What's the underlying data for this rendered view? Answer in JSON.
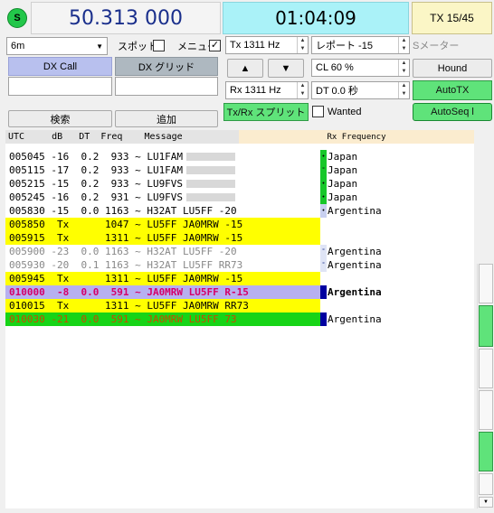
{
  "header": {
    "status_glyph": "S",
    "dial_frequency": "50.313 000",
    "utc_clock": "01:04:09",
    "tx_status": "TX 15/45"
  },
  "controls": {
    "band": "6m",
    "spot_label": "スポット",
    "menu_label": "メニュー",
    "menu_checked": "✓",
    "tx_freq": "Tx  1311  Hz",
    "report": "レポート -15",
    "smeter_label": "Sメーター",
    "cl": "CL  60 %",
    "rx_freq": "Rx  1311  Hz",
    "dt": "DT 0.0 秒",
    "hound": "Hound",
    "autotx": "AutoTX",
    "autoseq": "AutoSeq l",
    "txrx_split": "Tx/Rx スプリット",
    "wanted": "Wanted",
    "up_arrow": "▲",
    "down_arrow": "▼"
  },
  "dx": {
    "call_label": "DX Call",
    "grid_label": "DX グリッド",
    "search_button": "検索",
    "add_button": "追加"
  },
  "table": {
    "header": "UTC     dB   DT  Freq    Message",
    "rx_header": "Rx Frequency",
    "rows": [
      {
        "text": "005045 -16  0.2  933 ~ LU1FAM",
        "country": "Japan"
      },
      {
        "text": "005115 -17  0.2  933 ~ LU1FAM",
        "country": "Japan"
      },
      {
        "text": "005215 -15  0.2  933 ~ LU9FVS",
        "country": "Japan"
      },
      {
        "text": "005245 -16  0.2  931 ~ LU9FVS",
        "country": "Japan"
      },
      {
        "text": "005830 -15  0.0 1163 ~ H32AT LU5FF -20",
        "country": "Argentina"
      },
      {
        "text": "005850  Tx      1047 ~ LU5FF JA0MRW -15",
        "country": ""
      },
      {
        "text": "005915  Tx      1311 ~ LU5FF JA0MRW -15",
        "country": ""
      },
      {
        "text": "005900 -23  0.0 1163 ~ H32AT LU5FF -20",
        "country": "Argentina"
      },
      {
        "text": "005930 -20  0.1 1163 ~ H32AT LU5FF RR73",
        "country": "Argentina"
      },
      {
        "text": "005945  Tx      1311 ~ LU5FF JA0MRW -15",
        "country": ""
      },
      {
        "text": "010000  -8  0.0  591 ~ JA0MRW LU5FF R-15",
        "country": "Argentina"
      },
      {
        "text": "010015  Tx      1311 ~ LU5FF JA0MRW RR73",
        "country": ""
      },
      {
        "text": "010030 -21  0.0  591 ~ JA0MRW LU5FF 73",
        "country": "Argentina"
      }
    ]
  },
  "colors": {
    "green_dot": "#22c74a",
    "freq_text": "#1a2f8c",
    "time_bg": "#aaf2f8",
    "tx_row": "#ffff00",
    "cq_row": "#7bd87b",
    "to_me_row": "#b7b0f0",
    "to_me_text": "#d4006a",
    "last_row": "#17d417",
    "last_row_text": "#c84a00"
  }
}
